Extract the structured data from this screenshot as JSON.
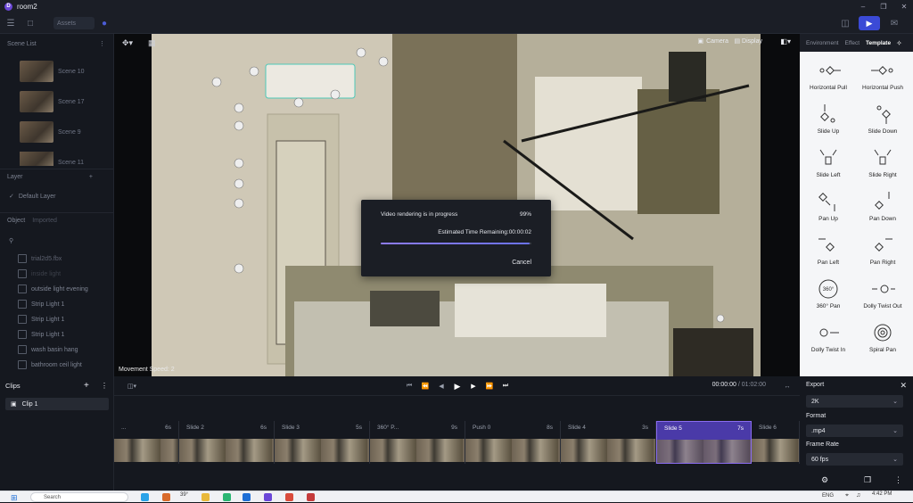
{
  "app": {
    "title": "room2",
    "logo_letter": "D"
  },
  "toolbar": {
    "assets_label": "Assets"
  },
  "scene_list": {
    "title": "Scene List",
    "scenes": [
      {
        "label": "Scene 10"
      },
      {
        "label": "Scene 17"
      },
      {
        "label": "Scene 9"
      },
      {
        "label": "Scene 11"
      }
    ]
  },
  "layer": {
    "title": "Layer",
    "items": [
      {
        "label": "Default Layer"
      }
    ]
  },
  "object": {
    "title": "Object",
    "tab_imported": "Imported",
    "items": [
      {
        "label": "trial2d5.fbx"
      },
      {
        "label": "inside light"
      },
      {
        "label": "outside light evening"
      },
      {
        "label": "Strip Light 1"
      },
      {
        "label": "Strip Light 1"
      },
      {
        "label": "Strip Light 1"
      },
      {
        "label": "wash basin hang"
      },
      {
        "label": "bathroom ceil light"
      }
    ]
  },
  "viewport": {
    "camera_label": "Camera",
    "display_label": "Display",
    "movement_speed": "Movement Speed: 2"
  },
  "render_dialog": {
    "title": "Video rendering is in progress",
    "percent": "99%",
    "progress": 0.99,
    "eta": "Estimated Time Remaining:00:00:02",
    "cancel_label": "Cancel"
  },
  "right_panel": {
    "tabs": [
      {
        "label": "Environment"
      },
      {
        "label": "Effect"
      },
      {
        "label": "Template"
      }
    ],
    "active_tab": "Template",
    "templates": [
      {
        "label": "Horizontal Pull"
      },
      {
        "label": "Horizontal Push"
      },
      {
        "label": "Slide Up"
      },
      {
        "label": "Slide Down"
      },
      {
        "label": "Slide Left"
      },
      {
        "label": "Slide Right"
      },
      {
        "label": "Pan Up"
      },
      {
        "label": "Pan Down"
      },
      {
        "label": "Pan Left"
      },
      {
        "label": "Pan Right"
      },
      {
        "label": "360° Pan"
      },
      {
        "label": "Dolly Twist Out"
      },
      {
        "label": "Dolly Twist In"
      },
      {
        "label": "Spiral Pan"
      }
    ],
    "pan360_glyph": "360°"
  },
  "clips": {
    "title": "Clips",
    "items": [
      {
        "label": "Clip 1"
      }
    ]
  },
  "timeline": {
    "current_time": "00:00:00",
    "total_time": " / 01:02:00",
    "slides": [
      {
        "name": "...",
        "duration": "6s"
      },
      {
        "name": "Slide 2",
        "duration": "6s"
      },
      {
        "name": "Slide 3",
        "duration": "5s"
      },
      {
        "name": "360° P...",
        "duration": "9s"
      },
      {
        "name": "Push 0",
        "duration": "8s"
      },
      {
        "name": "Slide 4",
        "duration": "3s"
      },
      {
        "name": "Slide 5",
        "duration": "7s"
      },
      {
        "name": "Slide 6",
        "duration": ""
      }
    ],
    "selected_slide": "Slide 5"
  },
  "export": {
    "title": "Export",
    "resolution": "2K",
    "format_label": "Format",
    "format": ".mp4",
    "frame_rate_label": "Frame Rate",
    "frame_rate": "60 fps"
  },
  "taskbar": {
    "search_placeholder": "Search",
    "temperature": "39°",
    "language": "ENG",
    "clock_time": "4:42 PM"
  },
  "colors": {
    "accent": "#6b47d8",
    "record_button": "#3b4ad6",
    "progress": "#8e7cf5",
    "selected_slide": "#4a3aa8"
  }
}
